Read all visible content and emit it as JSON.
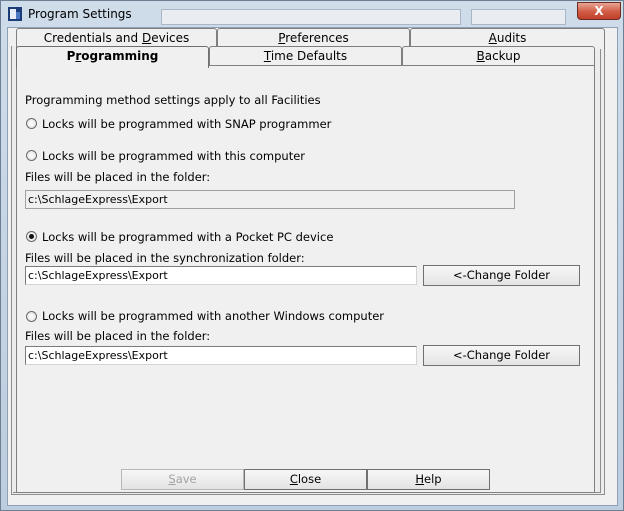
{
  "window": {
    "title": "Program Settings",
    "close_label": "X"
  },
  "tabs": {
    "row1": [
      {
        "pre": "Credentials and ",
        "ul": "D",
        "post": "evices"
      },
      {
        "pre": "",
        "ul": "P",
        "post": "references"
      },
      {
        "pre": "",
        "ul": "A",
        "post": "udits"
      }
    ],
    "row2": [
      {
        "pre": "P",
        "ul": "r",
        "post": "ogramming",
        "active": true
      },
      {
        "pre": "",
        "ul": "T",
        "post": "ime Defaults"
      },
      {
        "pre": "",
        "ul": "B",
        "post": "ackup"
      }
    ]
  },
  "programming": {
    "intro": "Programming method settings apply to all Facilities",
    "option_snap": "Locks will be programmed with SNAP programmer",
    "option_computer": "Locks will be programmed with this computer",
    "computer_folder_label": "Files will be placed in the folder:",
    "computer_folder_value": "c:\\SchlageExpress\\Export",
    "option_pocketpc": "Locks will be programmed with a Pocket PC device",
    "pocketpc_folder_label": "Files will be placed in the synchronization folder:",
    "pocketpc_folder_value": "c:\\SchlageExpress\\Export",
    "change_folder_label": "<-Change Folder",
    "option_windows": "Locks will be programmed with another Windows computer",
    "windows_folder_label": "Files will be placed in the folder:",
    "windows_folder_value": "c:\\SchlageExpress\\Export",
    "selected_option": "pocketpc"
  },
  "buttons": {
    "save": {
      "ul": "S",
      "post": "ave"
    },
    "close": {
      "ul": "C",
      "post": "lose"
    },
    "help": {
      "ul": "H",
      "post": "elp"
    }
  },
  "colors": {
    "title_bar": "#cfdcea",
    "close_button": "#cf5b44",
    "dialog_bg": "#f0f0f0"
  },
  "icons": {
    "app": "program-settings-app-icon",
    "close": "close-icon"
  }
}
